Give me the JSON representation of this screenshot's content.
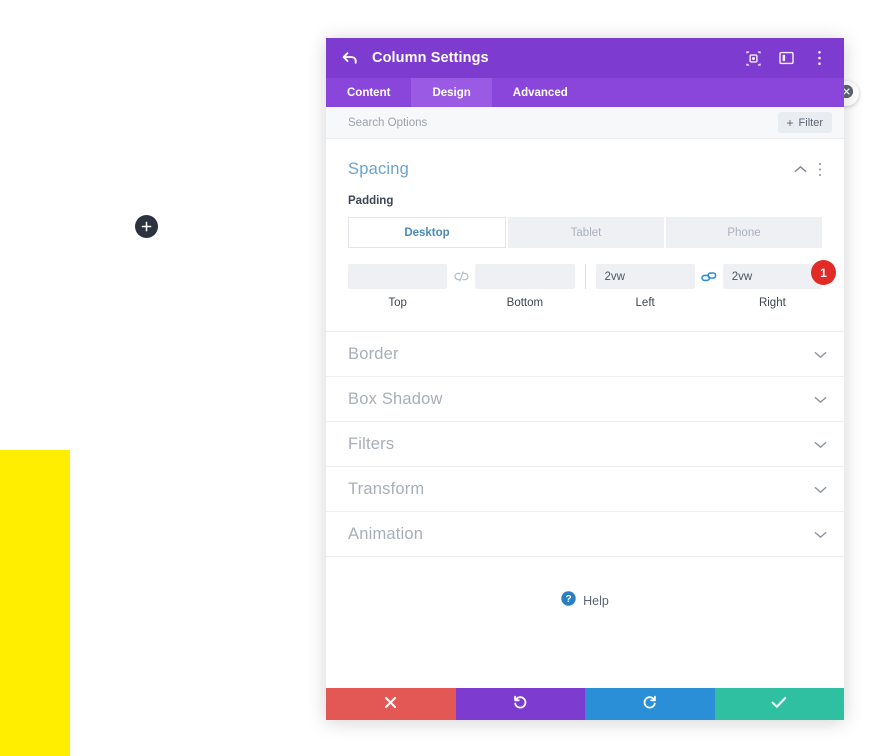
{
  "canvas": {
    "add_module_icon": "plus-icon",
    "close_icon": "close-circle-icon",
    "yellow_block_color": "#ffee00"
  },
  "panel": {
    "header": {
      "back_icon": "back-arrow-icon",
      "title": "Column Settings",
      "icons": [
        {
          "name": "focus-target-icon"
        },
        {
          "name": "layout-columns-icon"
        },
        {
          "name": "more-vertical-icon"
        }
      ],
      "background": "#7e3bd0"
    },
    "tabs": [
      {
        "label": "Content",
        "active": false
      },
      {
        "label": "Design",
        "active": true
      },
      {
        "label": "Advanced",
        "active": false
      }
    ],
    "search": {
      "placeholder": "Search Options",
      "value": ""
    },
    "filter": {
      "plus": "+",
      "label": "Filter"
    },
    "spacing": {
      "title": "Spacing",
      "collapse_icon": "chevron-up-icon",
      "more_icon": "more-vertical-icon",
      "field_label": "Padding",
      "devices": [
        {
          "label": "Desktop",
          "active": true
        },
        {
          "label": "Tablet",
          "active": false
        },
        {
          "label": "Phone",
          "active": false
        }
      ],
      "inputs": [
        {
          "caption": "Top",
          "value": "",
          "placeholder": ""
        },
        {
          "caption": "Bottom",
          "value": "",
          "placeholder": ""
        },
        {
          "caption": "Left",
          "value": "2vw",
          "placeholder": ""
        },
        {
          "caption": "Right",
          "value": "2vw",
          "placeholder": ""
        }
      ],
      "link_left": {
        "name": "link-broken-icon",
        "color": "#b8bfc7"
      },
      "link_right": {
        "name": "link-connected-icon",
        "color": "#2a8fd6"
      },
      "badge": {
        "value": "1",
        "color": "#e02b27"
      }
    },
    "sections": [
      {
        "title": "Border",
        "chevron": "chevron-down-icon"
      },
      {
        "title": "Box Shadow",
        "chevron": "chevron-down-icon"
      },
      {
        "title": "Filters",
        "chevron": "chevron-down-icon"
      },
      {
        "title": "Transform",
        "chevron": "chevron-down-icon"
      },
      {
        "title": "Animation",
        "chevron": "chevron-down-icon"
      }
    ],
    "help": {
      "icon": "help-circle-icon",
      "label": "Help"
    },
    "footer": [
      {
        "name": "cancel-button",
        "icon": "close-x-icon",
        "color": "#e35855"
      },
      {
        "name": "undo-button",
        "icon": "undo-icon",
        "color": "#7e3bd0"
      },
      {
        "name": "redo-button",
        "icon": "redo-icon",
        "color": "#2a8fd6"
      },
      {
        "name": "save-button",
        "icon": "check-icon",
        "color": "#2ec0a0"
      }
    ]
  }
}
